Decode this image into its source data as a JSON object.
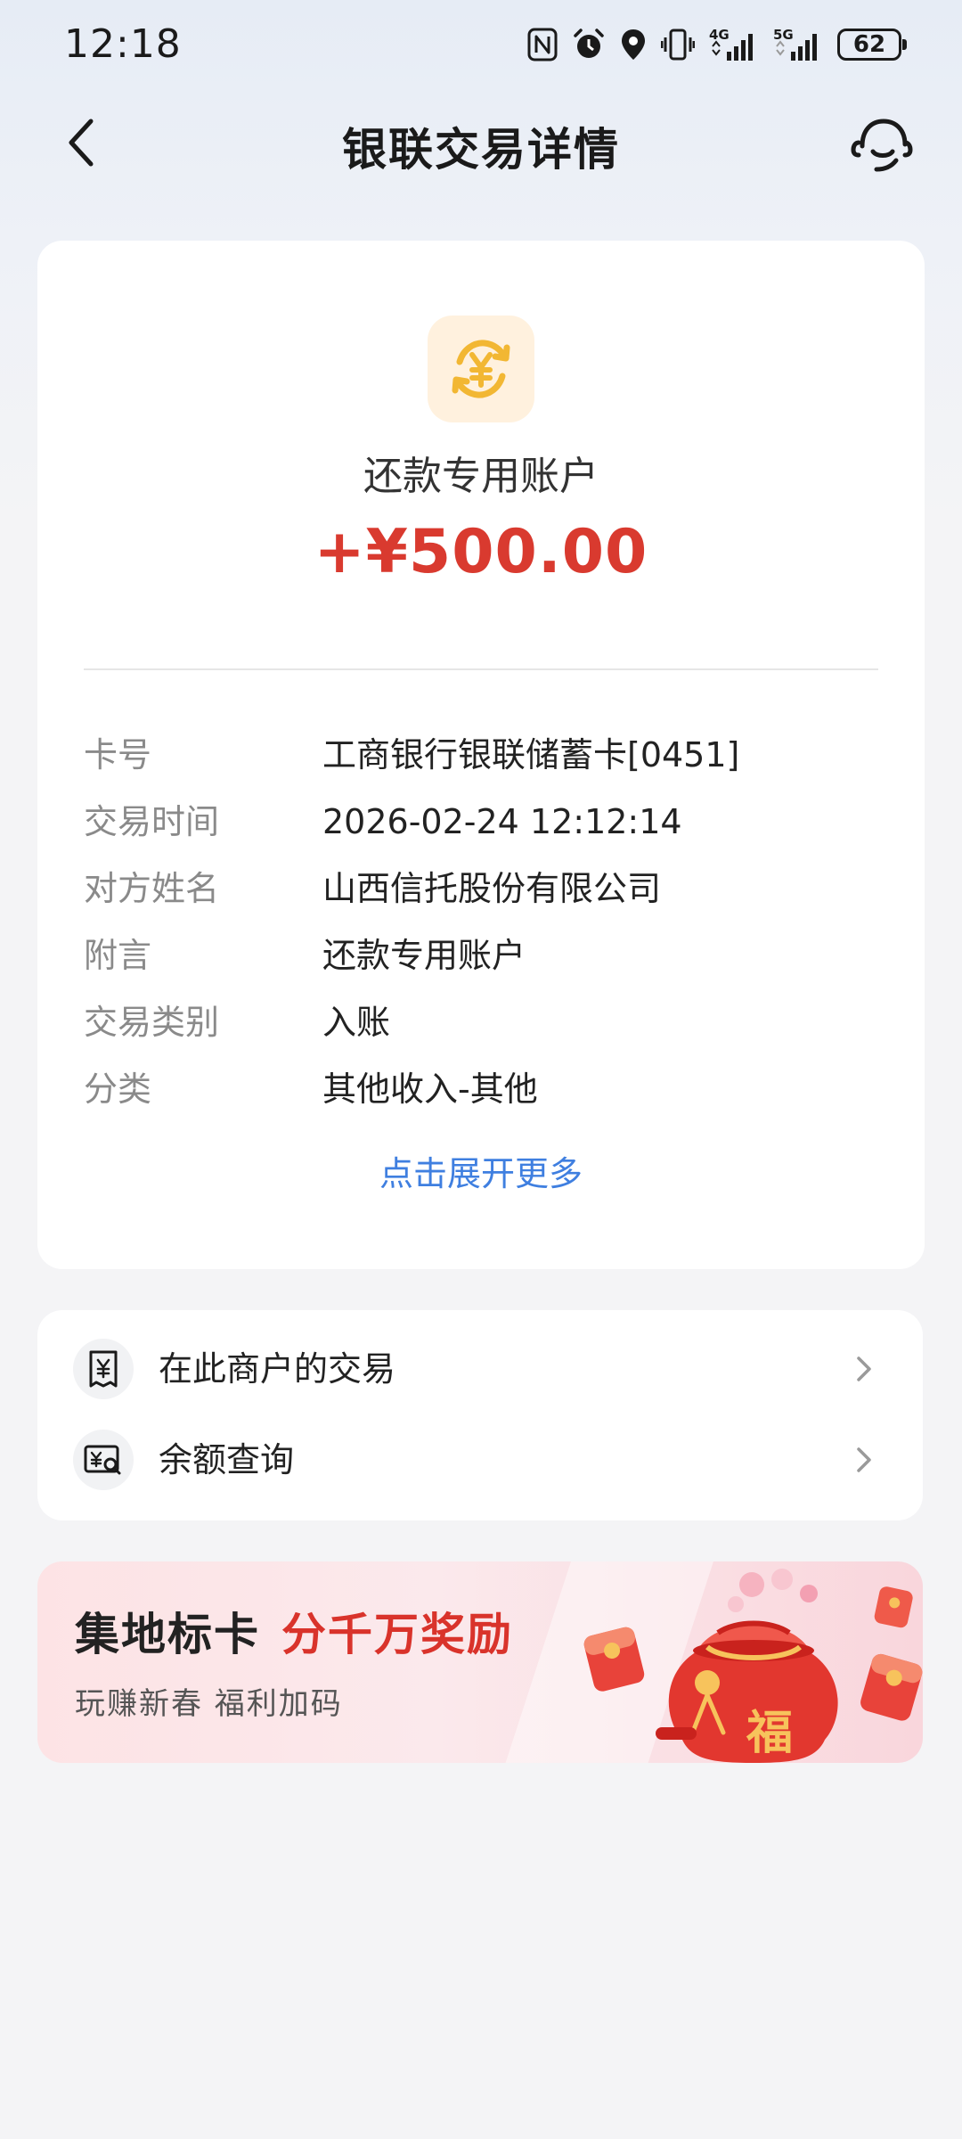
{
  "status_bar": {
    "time": "12:18",
    "battery": "62",
    "net_4g": "4G",
    "net_5g": "5G",
    "icons": [
      "nfc-icon",
      "alarm-icon",
      "location-icon",
      "vibrate-icon",
      "signal-4g-icon",
      "signal-5g-icon",
      "battery-icon"
    ]
  },
  "header": {
    "title": "银联交易详情",
    "back_icon": "chevron-left-icon",
    "service_icon": "headset-icon"
  },
  "transaction": {
    "icon": "yuan-exchange-icon",
    "account_name": "还款专用账户",
    "amount": "+¥500.00",
    "amount_color": "#d93a2f",
    "details": [
      {
        "label": "卡号",
        "value": "工商银行银联储蓄卡[0451]"
      },
      {
        "label": "交易时间",
        "value": "2026-02-24 12:12:14"
      },
      {
        "label": "对方姓名",
        "value": "山西信托股份有限公司"
      },
      {
        "label": "附言",
        "value": "还款专用账户"
      },
      {
        "label": "交易类别",
        "value": "入账"
      },
      {
        "label": "分类",
        "value": "其他收入-其他"
      }
    ],
    "expand_label": "点击展开更多",
    "link_color": "#3f7fe0"
  },
  "actions": [
    {
      "label": "在此商户的交易",
      "icon": "receipt-icon"
    },
    {
      "label": "余额查询",
      "icon": "balance-search-icon"
    }
  ],
  "promo": {
    "title_part1": "集地标卡",
    "title_part2": "分千万奖励",
    "subtitle": "玩赚新春 福利加码",
    "fu_char": "福",
    "accent_color": "#d9332b"
  }
}
